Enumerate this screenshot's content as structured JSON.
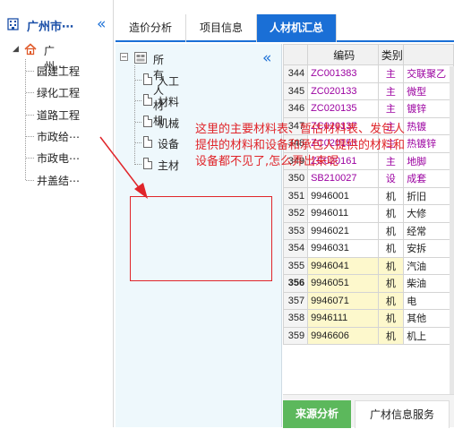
{
  "project_tree": {
    "title": "广州市⋯",
    "collapse_icon": "double-chevron-left",
    "root": {
      "label": "广州⋯",
      "expanded": true
    },
    "children": [
      "园建工程",
      "绿化工程",
      "道路工程",
      "市政给⋯",
      "市政电⋯",
      "井盖结⋯"
    ]
  },
  "tabs": [
    {
      "label": "造价分析",
      "active": false
    },
    {
      "label": "项目信息",
      "active": false
    },
    {
      "label": "人材机汇总",
      "active": true
    }
  ],
  "resource_tree": {
    "root": "所有人材机",
    "collapse_icon": "double-chevron-left",
    "items": [
      "人工",
      "材料",
      "机械",
      "设备",
      "主材"
    ]
  },
  "grid": {
    "headers": [
      "",
      "编码",
      "类别",
      ""
    ],
    "rows": [
      {
        "num": "344",
        "code": "ZC001383",
        "cat": "主",
        "name": "交联聚乙"
      },
      {
        "num": "345",
        "code": "ZC020133",
        "cat": "主",
        "name": "微型"
      },
      {
        "num": "346",
        "code": "ZC020135",
        "cat": "主",
        "name": "镀锌"
      },
      {
        "num": "347",
        "code": "ZC020137",
        "cat": "主",
        "name": "热镀"
      },
      {
        "num": "348",
        "code": "ZC020153",
        "cat": "主",
        "name": "热镀锌"
      },
      {
        "num": "349",
        "code": "ZC020161",
        "cat": "主",
        "name": "地脚"
      },
      {
        "num": "350",
        "code": "SB210027",
        "cat": "设",
        "name": "成套"
      },
      {
        "num": "351",
        "code": "9946001",
        "cat": "机",
        "name": "折旧"
      },
      {
        "num": "352",
        "code": "9946011",
        "cat": "机",
        "name": "大修"
      },
      {
        "num": "353",
        "code": "9946021",
        "cat": "机",
        "name": "经常"
      },
      {
        "num": "354",
        "code": "9946031",
        "cat": "机",
        "name": "安拆"
      },
      {
        "num": "355",
        "code": "9946041",
        "cat": "机",
        "name": "汽油"
      },
      {
        "num": "356",
        "code": "9946051",
        "cat": "机",
        "name": "柴油"
      },
      {
        "num": "357",
        "code": "9946071",
        "cat": "机",
        "name": "电"
      },
      {
        "num": "358",
        "code": "9946111",
        "cat": "机",
        "name": "其他"
      },
      {
        "num": "359",
        "code": "9946606",
        "cat": "机",
        "name": "机上"
      }
    ],
    "highlighted_rows": [
      "355",
      "356",
      "357",
      "358",
      "359"
    ],
    "current_row": "356"
  },
  "bottom_tabs": [
    {
      "label": "来源分析",
      "active": true
    },
    {
      "label": "广材信息服务",
      "active": false
    }
  ],
  "annotation": {
    "lines": [
      "这里的主要材料表、暂估材料表、发包人",
      "提供的材料和设备和承包人提供的材料和",
      "设备都不见了,怎么弄出来呢"
    ],
    "color": "#e0252a"
  },
  "colors": {
    "accent": "#1a6fd6",
    "panel_bg": "#eef8fc",
    "active_bottom_tab": "#5cb85c",
    "code_purple": "#9b00a0",
    "highlight": "#fdf8cc"
  }
}
